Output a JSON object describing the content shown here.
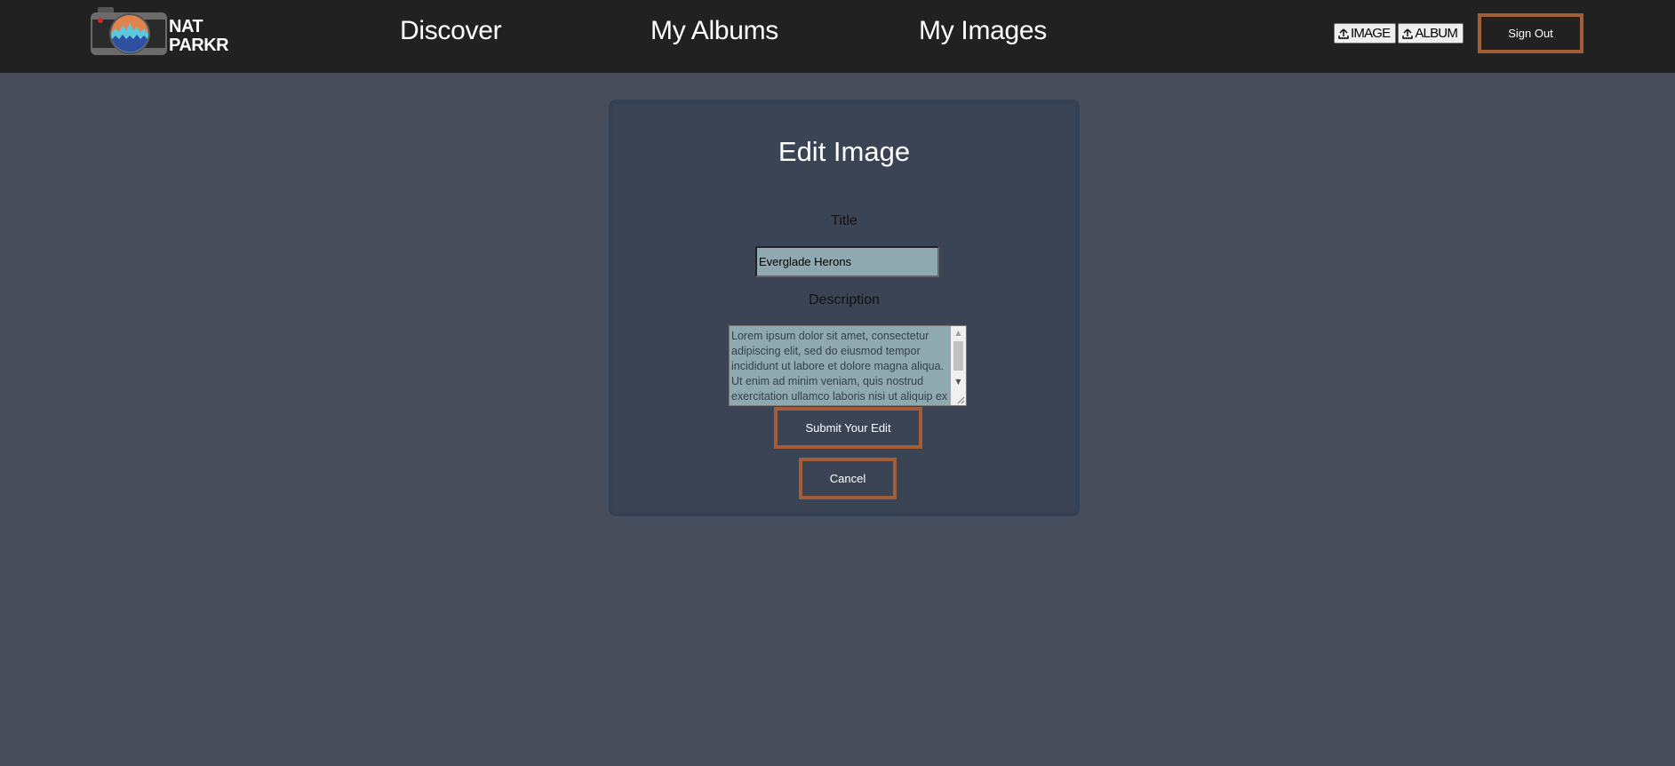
{
  "header": {
    "logo": {
      "line1": "NAT",
      "line2": "PARKR"
    },
    "nav": [
      {
        "label": "Discover"
      },
      {
        "label": "My Albums"
      },
      {
        "label": "My Images"
      }
    ],
    "upload_image_label": "IMAGE",
    "upload_album_label": "ALBUM",
    "sign_out_label": "Sign Out"
  },
  "form": {
    "title": "Edit Image",
    "title_label": "Title",
    "title_value": "Everglade Herons",
    "description_label": "Description",
    "description_value": "Lorem ipsum dolor sit amet, consectetur adipiscing elit, sed do eiusmod tempor incididunt ut labore et dolore magna aliqua. Ut enim ad minim veniam, quis nostrud exercitation ullamco laboris nisi ut aliquip ex ea commodo consequat.",
    "submit_label": "Submit Your Edit",
    "cancel_label": "Cancel"
  },
  "colors": {
    "accent": "#a35d37",
    "header_bg": "#212121",
    "page_bg": "#474d5a",
    "card_bg": "#3b4455",
    "input_bg": "#8fa9b0"
  }
}
